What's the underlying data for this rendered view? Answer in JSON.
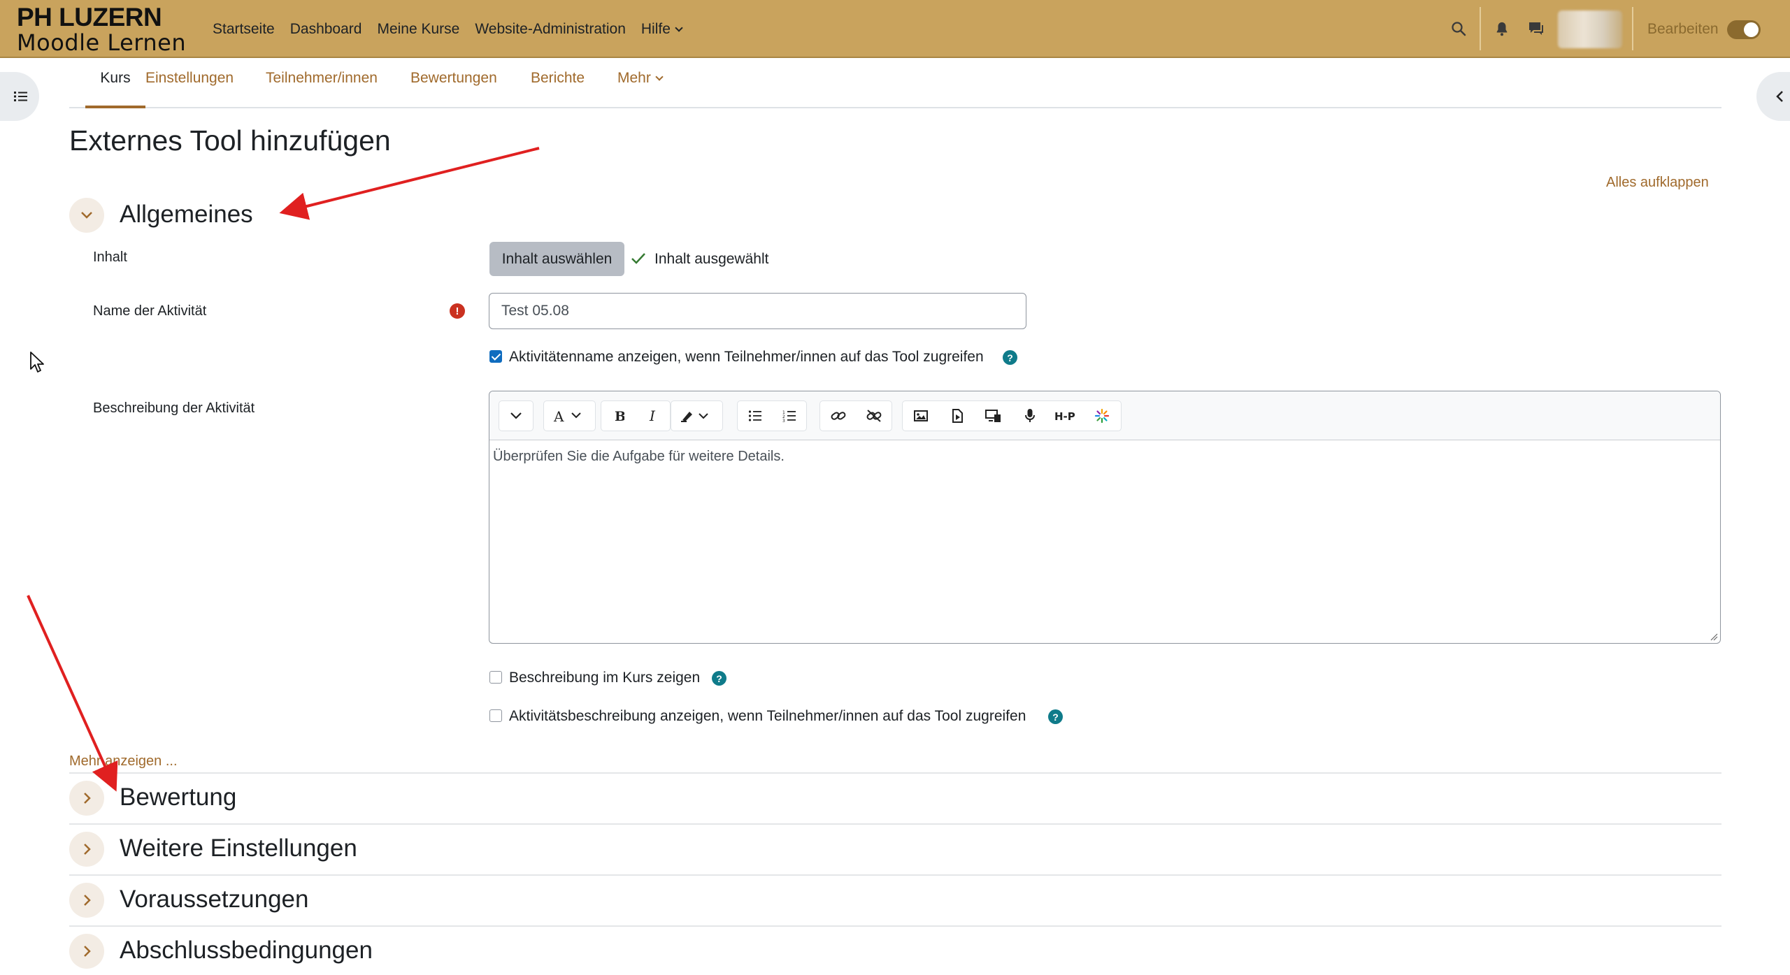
{
  "brand": {
    "line1": "PH LUZERN",
    "line2": "Moodle Lernen"
  },
  "primary_nav": {
    "items": [
      "Startseite",
      "Dashboard",
      "Meine Kurse",
      "Website-Administration"
    ],
    "more_label": "Hilfe"
  },
  "user_menu": {
    "edit_mode_label": "Bearbeiten",
    "edit_mode_on": true
  },
  "secondary_nav": {
    "tabs": [
      "Kurs",
      "Einstellungen",
      "Teilnehmer/innen",
      "Bewertungen",
      "Berichte"
    ],
    "more_label": "Mehr",
    "active_tab": "Kurs"
  },
  "page": {
    "title": "Externes Tool hinzufügen",
    "expand_all": "Alles aufklappen"
  },
  "general": {
    "title": "Allgemeines",
    "content_label": "Inhalt",
    "select_button": "Inhalt auswählen",
    "selected_status": "Inhalt ausgewählt",
    "name_label": "Name der Aktivität",
    "name_value": "Test 05.08",
    "show_name_label": "Aktivitätenname anzeigen, wenn Teilnehmer/innen auf das Tool zugreifen",
    "show_name_checked": true,
    "description_label": "Beschreibung der Aktivität",
    "description_value": "Überprüfen Sie die Aufgabe für weitere Details.",
    "show_in_course_label": "Beschreibung im Kurs zeigen",
    "show_in_course_checked": false,
    "show_desc_label": "Aktivitätsbeschreibung anzeigen, wenn Teilnehmer/innen auf das Tool zugreifen",
    "show_desc_checked": false,
    "show_more": "Mehr anzeigen ..."
  },
  "sections": [
    "Bewertung",
    "Weitere Einstellungen",
    "Voraussetzungen",
    "Abschlussbedingungen"
  ],
  "editor_toolbar_icons": [
    "chevron-down-icon",
    "font-color-icon",
    "bold-icon",
    "italic-icon",
    "highlight-icon",
    "bullet-list-icon",
    "numbered-list-icon",
    "link-icon",
    "unlink-icon",
    "image-icon",
    "media-icon",
    "embed-icon",
    "record-audio-icon",
    "h5p-icon",
    "ai-assist-icon"
  ],
  "colors": {
    "navbar": "#c9a35d",
    "link": "#a06a2c",
    "arrow": "#e02020",
    "required": "#ca3120",
    "help": "#0f7b8a",
    "checkbox": "#0f6cbf"
  }
}
